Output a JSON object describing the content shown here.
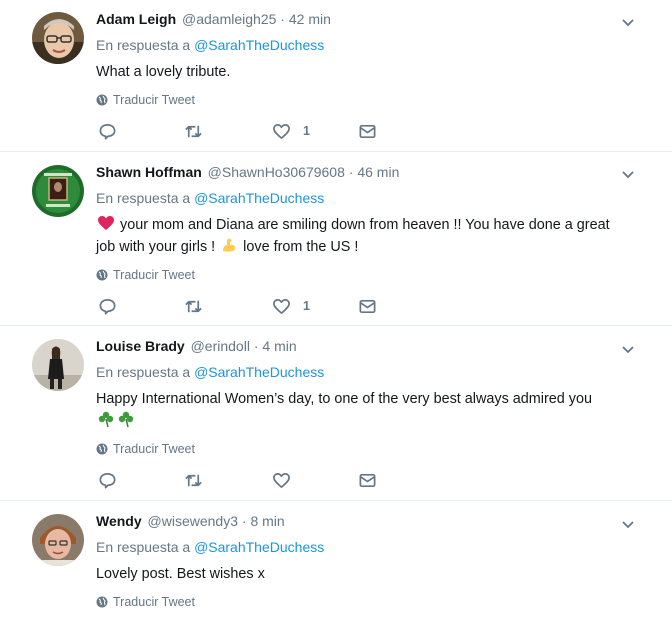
{
  "ui": {
    "reply_prefix": "En respuesta a",
    "translate_label": "Traducir Tweet",
    "separator": "·"
  },
  "colors": {
    "link": "#1b95e0",
    "muted": "#657786",
    "text": "#14171a",
    "divider": "#e6ecf0"
  },
  "tweets": [
    {
      "name": "Adam Leigh",
      "handle": "@adamleigh25",
      "time": "42 min",
      "reply_to": "@SarahTheDuchess",
      "text": "What a lovely tribute.",
      "like_count": "1",
      "avatar_icon": "man-with-glasses-avatar"
    },
    {
      "name": "Shawn Hoffman",
      "handle": "@ShawnHo30679608",
      "time": "46 min",
      "reply_to": "@SarahTheDuchess",
      "text_a": "your mom and Diana are smiling down from heaven !! You have done a great job with your girls !",
      "text_b": "love from the US !",
      "like_count": "1",
      "avatar_icon": "green-framed-portrait-avatar"
    },
    {
      "name": "Louise Brady",
      "handle": "@erindoll",
      "time": "4 min",
      "reply_to": "@SarahTheDuchess",
      "text": "Happy International Women’s day, to one of the very best always admired you",
      "like_count": "",
      "avatar_icon": "woman-standing-avatar"
    },
    {
      "name": "Wendy",
      "handle": "@wisewendy3",
      "time": "8 min",
      "reply_to": "@SarahTheDuchess",
      "text": "Lovely post. Best wishes x",
      "like_count": "",
      "avatar_icon": "older-woman-avatar"
    }
  ]
}
